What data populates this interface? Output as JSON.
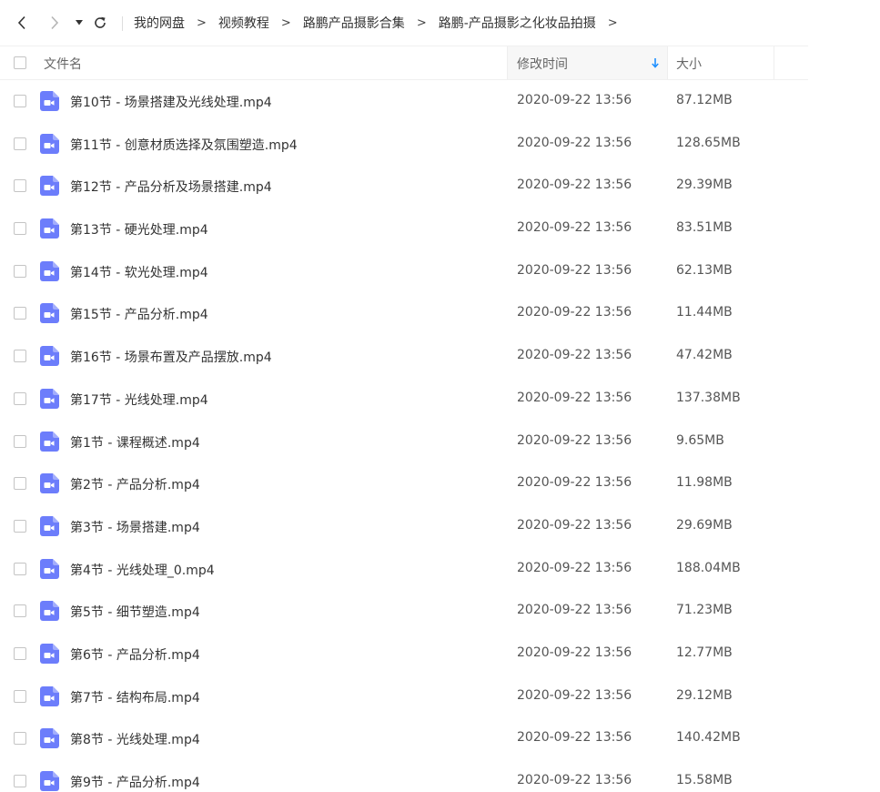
{
  "navigation": {
    "back_icon": "chevron-left-icon",
    "forward_icon": "chevron-right-icon",
    "dropdown_icon": "caret-down-icon",
    "refresh_icon": "refresh-icon",
    "breadcrumb": [
      "我的网盘",
      "视频教程",
      "路鹏产品摄影合集",
      "路鹏-产品摄影之化妆品拍摄"
    ],
    "separator": ">"
  },
  "table": {
    "headers": {
      "name": "文件名",
      "modified": "修改时间",
      "size": "大小"
    },
    "sort_icon": "arrow-down-icon",
    "file_icon": "video-file-icon",
    "accent_color": "#6c7dfb",
    "sort_color": "#1e90ff",
    "rows": [
      {
        "name": "第10节 - 场景搭建及光线处理.mp4",
        "modified": "2020-09-22 13:56",
        "size": "87.12MB"
      },
      {
        "name": "第11节 - 创意材质选择及氛围塑造.mp4",
        "modified": "2020-09-22 13:56",
        "size": "128.65MB"
      },
      {
        "name": "第12节 - 产品分析及场景搭建.mp4",
        "modified": "2020-09-22 13:56",
        "size": "29.39MB"
      },
      {
        "name": "第13节 - 硬光处理.mp4",
        "modified": "2020-09-22 13:56",
        "size": "83.51MB"
      },
      {
        "name": "第14节 - 软光处理.mp4",
        "modified": "2020-09-22 13:56",
        "size": "62.13MB"
      },
      {
        "name": "第15节 - 产品分析.mp4",
        "modified": "2020-09-22 13:56",
        "size": "11.44MB"
      },
      {
        "name": "第16节 - 场景布置及产品摆放.mp4",
        "modified": "2020-09-22 13:56",
        "size": "47.42MB"
      },
      {
        "name": "第17节 - 光线处理.mp4",
        "modified": "2020-09-22 13:56",
        "size": "137.38MB"
      },
      {
        "name": "第1节 - 课程概述.mp4",
        "modified": "2020-09-22 13:56",
        "size": "9.65MB"
      },
      {
        "name": "第2节 - 产品分析.mp4",
        "modified": "2020-09-22 13:56",
        "size": "11.98MB"
      },
      {
        "name": "第3节 - 场景搭建.mp4",
        "modified": "2020-09-22 13:56",
        "size": "29.69MB"
      },
      {
        "name": "第4节 - 光线处理_0.mp4",
        "modified": "2020-09-22 13:56",
        "size": "188.04MB"
      },
      {
        "name": "第5节 - 细节塑造.mp4",
        "modified": "2020-09-22 13:56",
        "size": "71.23MB"
      },
      {
        "name": "第6节 - 产品分析.mp4",
        "modified": "2020-09-22 13:56",
        "size": "12.77MB"
      },
      {
        "name": "第7节 - 结构布局.mp4",
        "modified": "2020-09-22 13:56",
        "size": "29.12MB"
      },
      {
        "name": "第8节 - 光线处理.mp4",
        "modified": "2020-09-22 13:56",
        "size": "140.42MB"
      },
      {
        "name": "第9节 - 产品分析.mp4",
        "modified": "2020-09-22 13:56",
        "size": "15.58MB"
      }
    ]
  }
}
